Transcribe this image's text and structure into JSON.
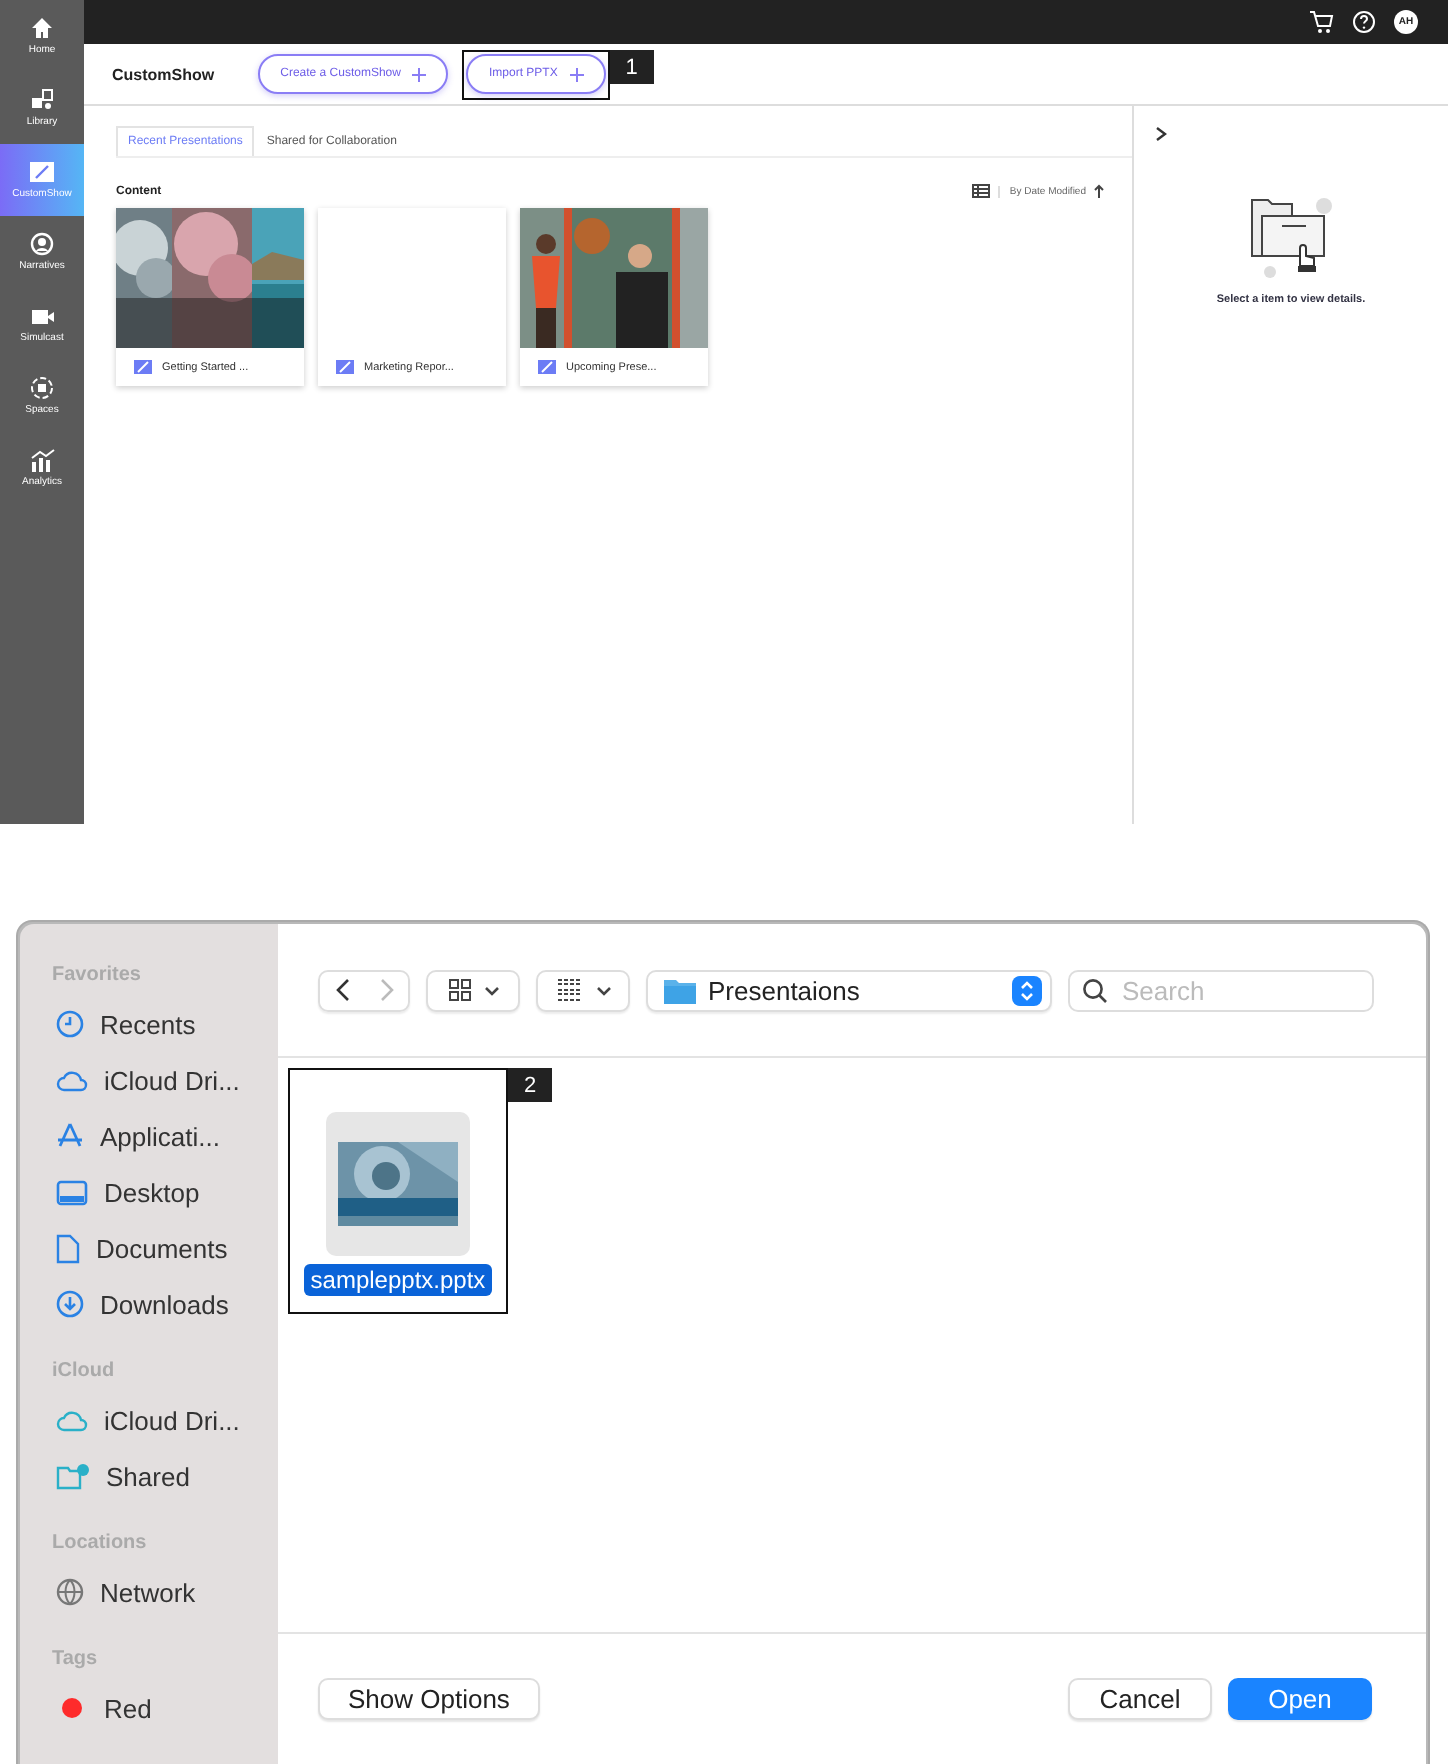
{
  "app": {
    "nav": [
      {
        "label": "Home",
        "selected": false
      },
      {
        "label": "Library",
        "selected": false
      },
      {
        "label": "CustomShow",
        "selected": true
      },
      {
        "label": "Narratives",
        "selected": false
      },
      {
        "label": "Simulcast",
        "selected": false
      },
      {
        "label": "Spaces",
        "selected": false
      },
      {
        "label": "Analytics",
        "selected": false
      }
    ],
    "avatar": "AH",
    "title": "CustomShow",
    "buttons": [
      {
        "label": "Create a CustomShow"
      },
      {
        "label": "Import PPTX",
        "callout": "1"
      }
    ],
    "tabs": [
      {
        "label": "Recent Presentations",
        "selected": true
      },
      {
        "label": "Shared for Collaboration",
        "selected": false
      }
    ],
    "section_title": "Content",
    "sort": "By Date Modified",
    "cards": [
      {
        "title": "Getting Started ...",
        "kind": "picture"
      },
      {
        "title": "Marketing Repor...",
        "kind": "blank"
      },
      {
        "title": "Upcoming Prese...",
        "kind": "picture"
      }
    ],
    "details_message": "Select a item to view details."
  },
  "dialog": {
    "sidebar": [
      {
        "heading": "Favorites",
        "items": [
          {
            "label": "Recents"
          },
          {
            "label": "iCloud Dri..."
          },
          {
            "label": "Applicati..."
          },
          {
            "label": "Desktop"
          },
          {
            "label": "Documents"
          },
          {
            "label": "Downloads"
          }
        ]
      },
      {
        "heading": "iCloud",
        "items": [
          {
            "label": "iCloud Dri..."
          },
          {
            "label": "Shared"
          }
        ]
      },
      {
        "heading": "Locations",
        "items": [
          {
            "label": "Network"
          }
        ]
      },
      {
        "heading": "Tags",
        "items": [
          {
            "label": "Red",
            "color": "#fe2b2b"
          }
        ]
      }
    ],
    "location": "Presentaions",
    "search_placeholder": "Search",
    "files": [
      {
        "name": "samplepptx.pptx",
        "selected": true,
        "callout": "2"
      }
    ],
    "options_button": "Show Options",
    "buttons": [
      {
        "label": "Cancel",
        "default": false
      },
      {
        "label": "Open",
        "default": true
      }
    ]
  }
}
